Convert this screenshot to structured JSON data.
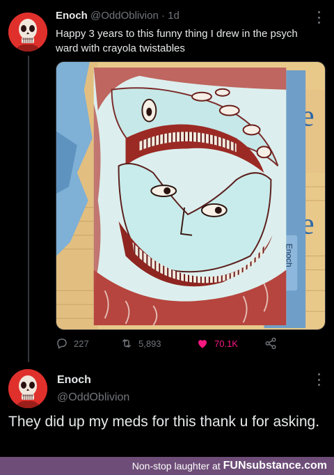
{
  "tweet": {
    "author_name": "Enoch",
    "handle": "@OddOblivion",
    "separator": "·",
    "time": "1d",
    "text": "Happy 3 years to this funny thing I drew in the psych ward with crayola twistables",
    "image_signature": "Enoch",
    "stats": {
      "replies": "227",
      "retweets": "5,893",
      "likes": "70.1K"
    },
    "liked": true
  },
  "reply": {
    "author_name": "Enoch",
    "handle": "@OddOblivion",
    "text": "They did up my meds for this thank u for asking."
  },
  "footer": {
    "text": "Non-stop laughter at",
    "brand": "FUNsubstance.com"
  },
  "colors": {
    "background": "#000000",
    "text": "#e7e9ea",
    "muted": "#71767b",
    "like": "#f91880",
    "footer": "#6e4e78"
  },
  "icons": [
    "reply-icon",
    "retweet-icon",
    "heart-icon",
    "share-icon",
    "more-icon"
  ]
}
